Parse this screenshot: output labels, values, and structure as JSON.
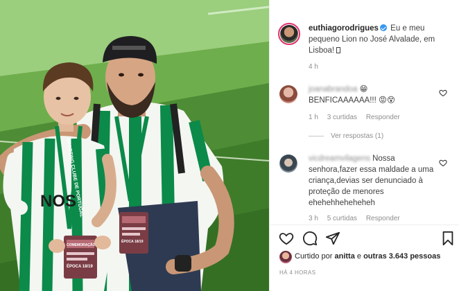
{
  "post": {
    "username": "euthiagorodrigues",
    "caption_text": "Eu e meu pequeno Lion no José Alvalade, em Lisboa!",
    "caption_time": "4 h"
  },
  "comments": [
    {
      "username": "joanabrandoa",
      "username_suffix": "😁",
      "text": "BENFICAAAAAA!!! 😡😵",
      "time": "1 h",
      "likes_label": "3 curtidas",
      "reply_label": "Responder",
      "view_replies": "Ver respostas (1)"
    },
    {
      "username": "vicdreamvilagens",
      "text": "Nossa senhora,fazer essa maldade a uma criança,devias ser denunciado à proteção de menores ehehehheheheheh",
      "time": "3 h",
      "likes_label": "5 curtidas",
      "reply_label": "Responder"
    }
  ],
  "likes": {
    "prefix": "Curtido por",
    "user": "anitta",
    "connector": "e",
    "others": "outras 3.643 pessoas"
  },
  "post_time": "HÁ 4 HORAS",
  "photo": {
    "badge_text": "SPORTING CLUBE DE PORTUGAL",
    "shirt_text": "NOS",
    "card_line1": "COMEMORAÇÃO",
    "card_line2": "ÉPOCA 18/19",
    "card_subtext": "ÉPOCA 18/19"
  },
  "colors": {
    "sporting_green": "#0b8a4a",
    "verified_blue": "#3897f0",
    "muted_text": "#8e8e8e"
  }
}
